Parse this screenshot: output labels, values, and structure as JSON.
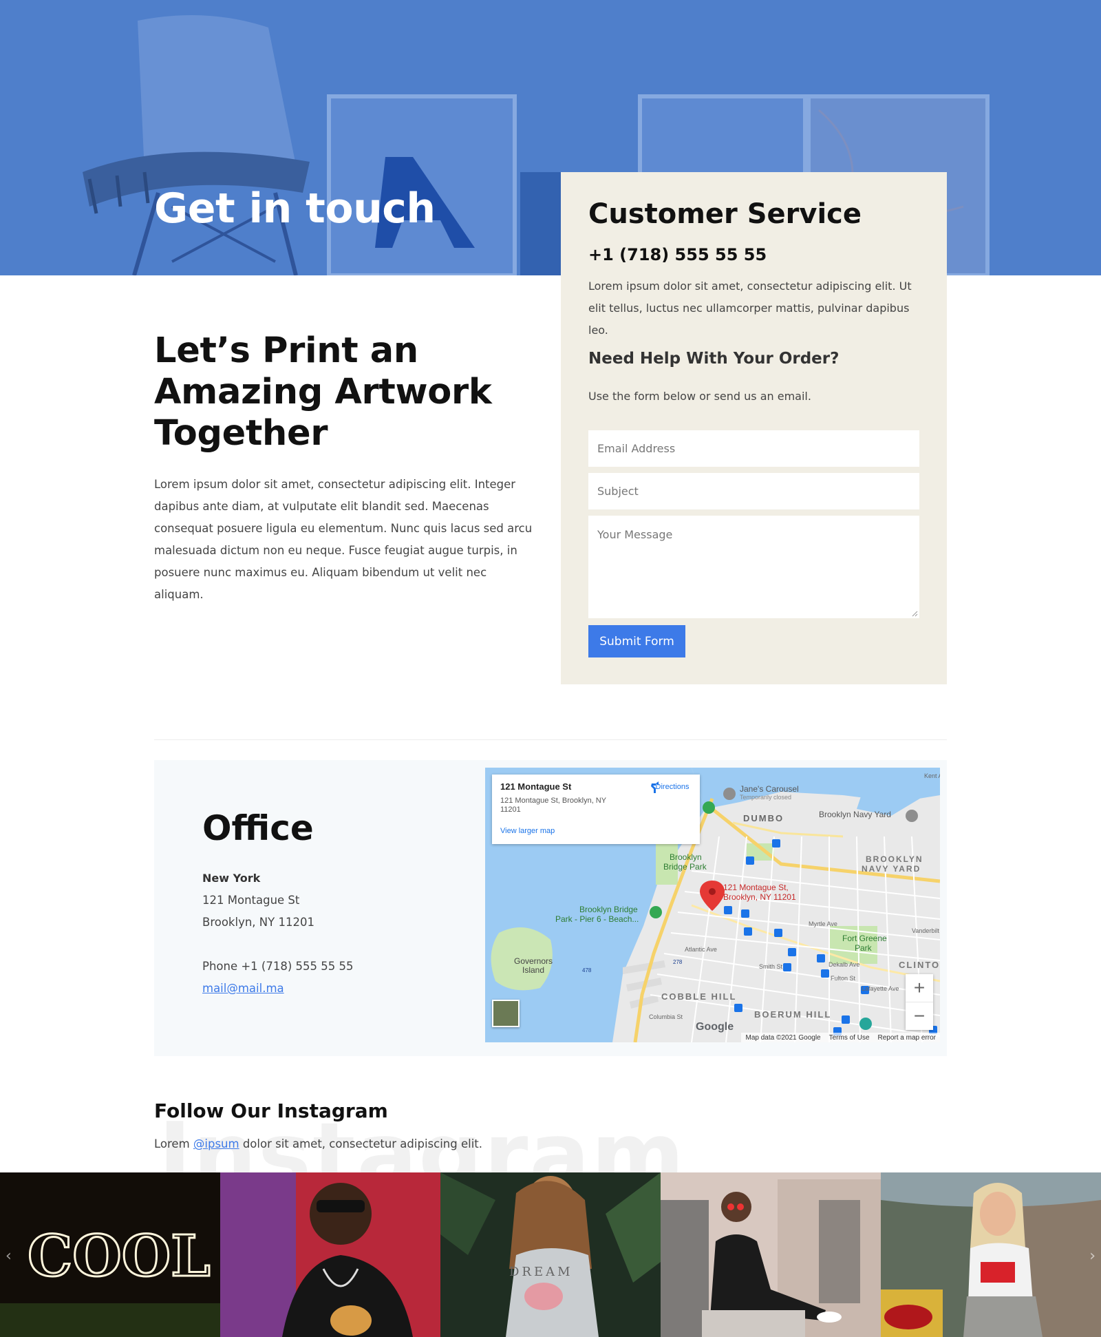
{
  "hero": {
    "title": "Get in touch"
  },
  "intro": {
    "heading_line1": "Let’s Print an",
    "heading_line2": "Amazing Artwork",
    "heading_line3": "Together",
    "text": "Lorem ipsum dolor sit amet, consectetur adipiscing elit. Integer dapibus ante diam, at vulputate elit blandit sed. Maecenas consequat posuere ligula eu elementum. Nunc quis lacus sed arcu malesuada dictum non eu neque. Fusce feugiat augue turpis, in posuere nunc maximus eu. Aliquam bibendum ut velit nec aliquam."
  },
  "customer_service": {
    "title": "Customer Service",
    "phone": "+1 (718) 555 55 55",
    "description": "Lorem ipsum dolor sit amet, consectetur adipiscing elit. Ut elit tellus, luctus nec ullamcorper mattis, pulvinar dapibus leo.",
    "help_heading": "Need Help With Your Order?",
    "help_text": "Use the form below or send us an email.",
    "form": {
      "email_placeholder": "Email Address",
      "subject_placeholder": "Subject",
      "message_placeholder": "Your Message",
      "submit_label": "Submit Form"
    },
    "colors": {
      "card_bg": "#f1eee4",
      "button": "#3d7ae8"
    }
  },
  "office": {
    "title": "Office",
    "city": "New York",
    "street": "121 Montague St",
    "city_line": "Brooklyn, NY 11201",
    "phone": "Phone +1 (718) 555 55 55",
    "email": "mail@mail.ma"
  },
  "map": {
    "info_title": "121 Montague St",
    "info_address": "121 Montague St, Brooklyn, NY 11201",
    "view_larger": "View larger map",
    "directions": "Directions",
    "pin_label_line1": "121 Montague St,",
    "pin_label_line2": "Brooklyn, NY 11201",
    "labels": {
      "carousel": "Jane's Carousel",
      "carousel_sub": "Temporarily closed",
      "dumbo": "DUMBO",
      "navy_yard": "Brooklyn Navy Yard",
      "brooklyn": "BROOKLYN",
      "navy_yard_area": "NAVY YARD",
      "bridge_park_1": "Brooklyn",
      "bridge_park_2": "Bridge Park",
      "pier6_1": "Brooklyn Bridge",
      "pier6_2": "Park - Pier 6 - Beach...",
      "governors_1": "Governors",
      "governors_2": "Island",
      "fort_greene_1": "Fort Greene",
      "fort_greene_2": "Park",
      "myrtle": "Myrtle Ave",
      "atlantic": "Atlantic Ave",
      "dekalb": "Dekalb Ave",
      "fulton": "Fulton St",
      "lafayette": "Lafayette Ave",
      "smith": "Smith St",
      "columbia": "Columbia St",
      "vanderbilt": "Vanderbilt Ave",
      "kent": "Kent Ave",
      "cobble_hill": "COBBLE HILL",
      "boerum_hill": "BOERUM HILL",
      "clinton": "CLINTO",
      "i278": "278",
      "i478": "478"
    },
    "google": "Google",
    "footer": [
      "Map data ©2021 Google",
      "Terms of Use",
      "Report a map error"
    ]
  },
  "instagram": {
    "title": "Follow Our Instagram",
    "text_before": "Lorem ",
    "handle": "@ipsum",
    "text_after": " dolor sit amet, consectetur adipiscing elit.",
    "bg_word": "Instagram",
    "tile1_text": "COOL",
    "tile3_text": "DREAM",
    "prev_icon": "chevron-left-icon",
    "next_icon": "chevron-right-icon"
  }
}
